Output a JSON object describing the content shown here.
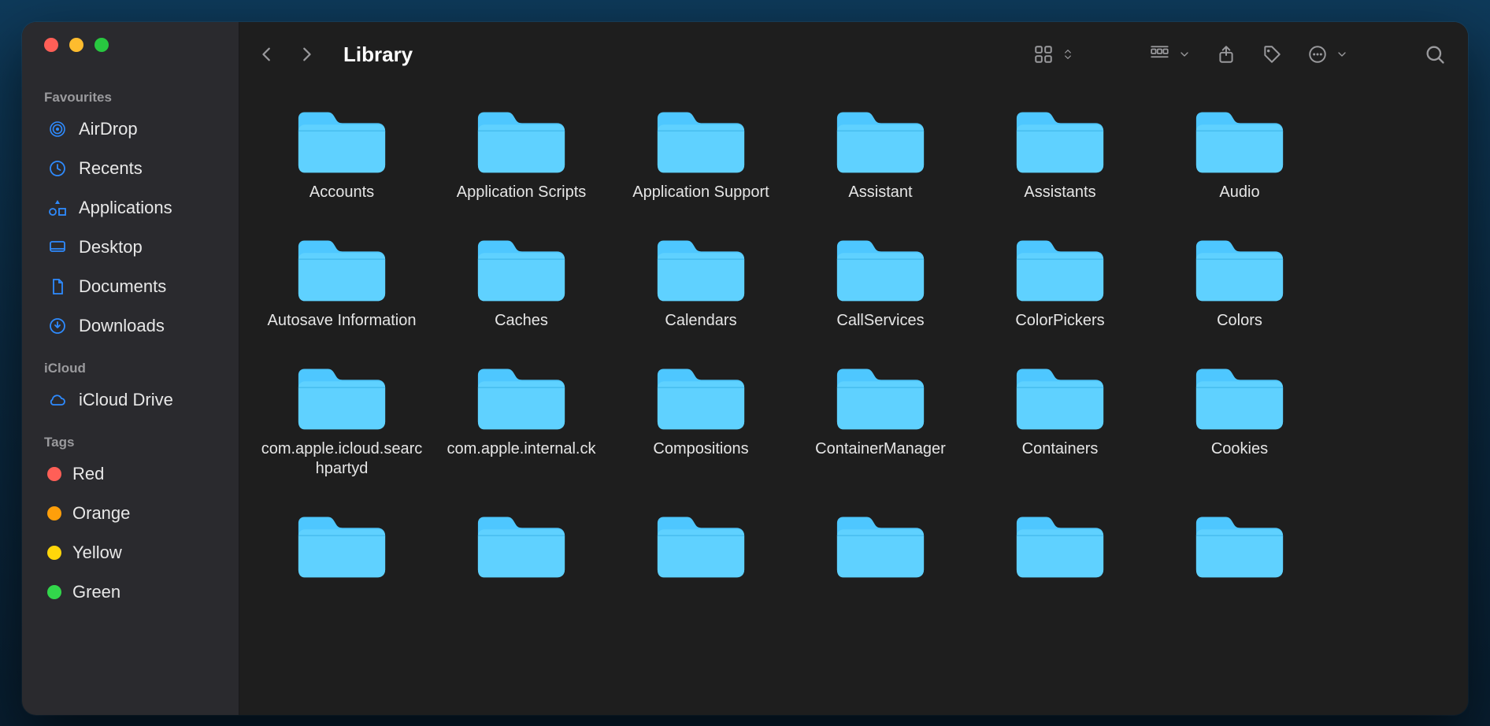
{
  "window": {
    "title": "Library"
  },
  "sidebar": {
    "sections": [
      {
        "title": "Favourites",
        "items": [
          {
            "label": "AirDrop",
            "icon": "airdrop-icon"
          },
          {
            "label": "Recents",
            "icon": "clock-icon"
          },
          {
            "label": "Applications",
            "icon": "applications-icon"
          },
          {
            "label": "Desktop",
            "icon": "desktop-icon"
          },
          {
            "label": "Documents",
            "icon": "document-icon"
          },
          {
            "label": "Downloads",
            "icon": "download-icon"
          }
        ]
      },
      {
        "title": "iCloud",
        "items": [
          {
            "label": "iCloud Drive",
            "icon": "cloud-icon"
          }
        ]
      },
      {
        "title": "Tags",
        "items": [
          {
            "label": "Red",
            "tagColor": "tag-red"
          },
          {
            "label": "Orange",
            "tagColor": "tag-orange"
          },
          {
            "label": "Yellow",
            "tagColor": "tag-yellow"
          },
          {
            "label": "Green",
            "tagColor": "tag-green"
          }
        ]
      }
    ]
  },
  "folders": [
    {
      "name": "Accounts"
    },
    {
      "name": "Application Scripts"
    },
    {
      "name": "Application Support"
    },
    {
      "name": "Assistant"
    },
    {
      "name": "Assistants"
    },
    {
      "name": "Audio"
    },
    {
      "name": "Autosave Information"
    },
    {
      "name": "Caches"
    },
    {
      "name": "Calendars"
    },
    {
      "name": "CallServices"
    },
    {
      "name": "ColorPickers"
    },
    {
      "name": "Colors"
    },
    {
      "name": "com.apple.icloud.searchpartyd"
    },
    {
      "name": "com.apple.internal.ck"
    },
    {
      "name": "Compositions"
    },
    {
      "name": "ContainerManager"
    },
    {
      "name": "Containers"
    },
    {
      "name": "Cookies"
    },
    {
      "name": ""
    },
    {
      "name": ""
    },
    {
      "name": ""
    },
    {
      "name": ""
    },
    {
      "name": ""
    },
    {
      "name": ""
    }
  ]
}
